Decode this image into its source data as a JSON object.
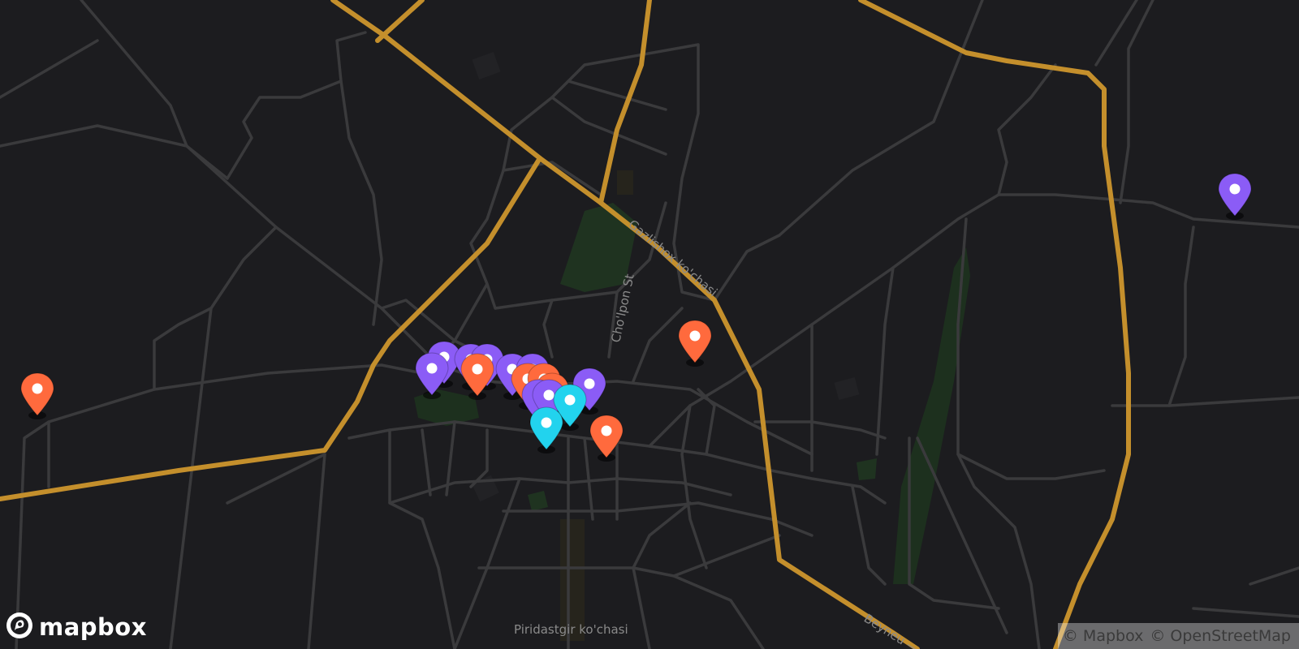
{
  "map": {
    "street_labels": {
      "gazlishox": "Gazlishox ko'chasi",
      "cholpon": "Cho'lpon St",
      "piridastgir": "Piridastgir ko'chasi",
      "beyneu": "Beyneu — S"
    },
    "colors": {
      "background": "#1c1c1f",
      "minor_road": "#3a3a3c",
      "major_road": "#c48f2c",
      "park": "#1f3320",
      "marker_orange": "#ff6a3d",
      "marker_purple": "#8b5cf6",
      "marker_cyan": "#22d3ee"
    },
    "markers": [
      {
        "color": "orange",
        "name": "marker-orange"
      },
      {
        "color": "purple",
        "name": "marker-purple"
      },
      {
        "color": "orange",
        "name": "marker-orange"
      },
      {
        "color": "purple",
        "name": "marker-purple"
      },
      {
        "color": "purple",
        "name": "marker-purple"
      },
      {
        "color": "purple",
        "name": "marker-purple"
      },
      {
        "color": "purple",
        "name": "marker-purple"
      },
      {
        "color": "orange",
        "name": "marker-orange"
      },
      {
        "color": "purple",
        "name": "marker-purple"
      },
      {
        "color": "purple",
        "name": "marker-purple"
      },
      {
        "color": "orange",
        "name": "marker-orange"
      },
      {
        "color": "orange",
        "name": "marker-orange"
      },
      {
        "color": "purple",
        "name": "marker-purple"
      },
      {
        "color": "purple",
        "name": "marker-purple"
      },
      {
        "color": "purple",
        "name": "marker-purple"
      },
      {
        "color": "cyan",
        "name": "marker-cyan"
      },
      {
        "color": "cyan",
        "name": "marker-cyan"
      },
      {
        "color": "orange",
        "name": "marker-orange"
      },
      {
        "color": "orange",
        "name": "marker-orange"
      }
    ]
  },
  "logo": {
    "text": "mapbox",
    "icon": "mapbox-logo-icon"
  },
  "attribution": {
    "mapbox": "© Mapbox",
    "osm": "© OpenStreetMap"
  }
}
